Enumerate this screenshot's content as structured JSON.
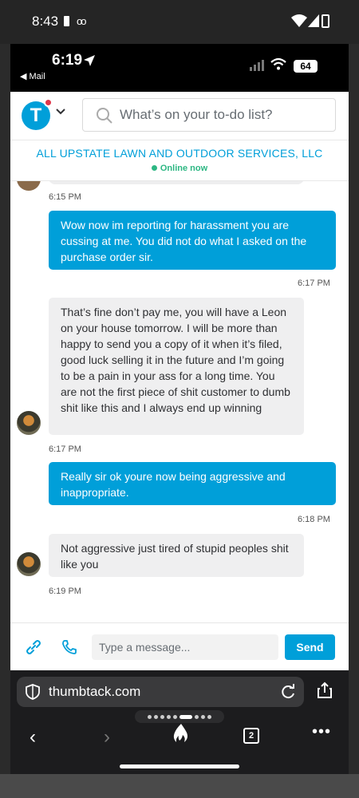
{
  "android_status": {
    "time": "8:43"
  },
  "ios_status": {
    "time": "6:19",
    "back_label": "◀ Mail",
    "battery": "64"
  },
  "header": {
    "logo_letter": "T",
    "search_placeholder": "What’s on your to-do list?"
  },
  "pro": {
    "name": "ALL UPSTATE LAWN AND OUTDOOR SERVICES, LLC",
    "status": "Online now"
  },
  "messages": [
    {
      "time": "6:15 PM"
    },
    {
      "from": "me",
      "text": "Wow now im reporting for harassment you are cussing at me. You did not do what I asked on the purchase order sir.",
      "time": "6:17 PM"
    },
    {
      "from": "pro",
      "text": "That’s fine don’t pay me, you will have a Leon on your house tomorrow. I will be more than happy to send you a copy of it when it’s filed, good luck selling it in the future and I’m going to be a pain in your ass for a long time. You are not the first piece of shit customer to dumb shit like this and I always end up winning",
      "time": "6:17 PM"
    },
    {
      "from": "me",
      "text": "Really sir ok youre now being aggressive and inappropriate.",
      "time": "6:18 PM"
    },
    {
      "from": "pro",
      "text": "Not aggressive just tired of stupid peoples shit like you",
      "time": "6:19 PM"
    }
  ],
  "composer": {
    "placeholder": "Type a message...",
    "send_label": "Send"
  },
  "browser": {
    "url": "thumbtack.com",
    "tab_count": "2"
  },
  "colors": {
    "accent": "#009fd9",
    "online": "#2db783",
    "incoming_bubble": "#efeff0"
  }
}
